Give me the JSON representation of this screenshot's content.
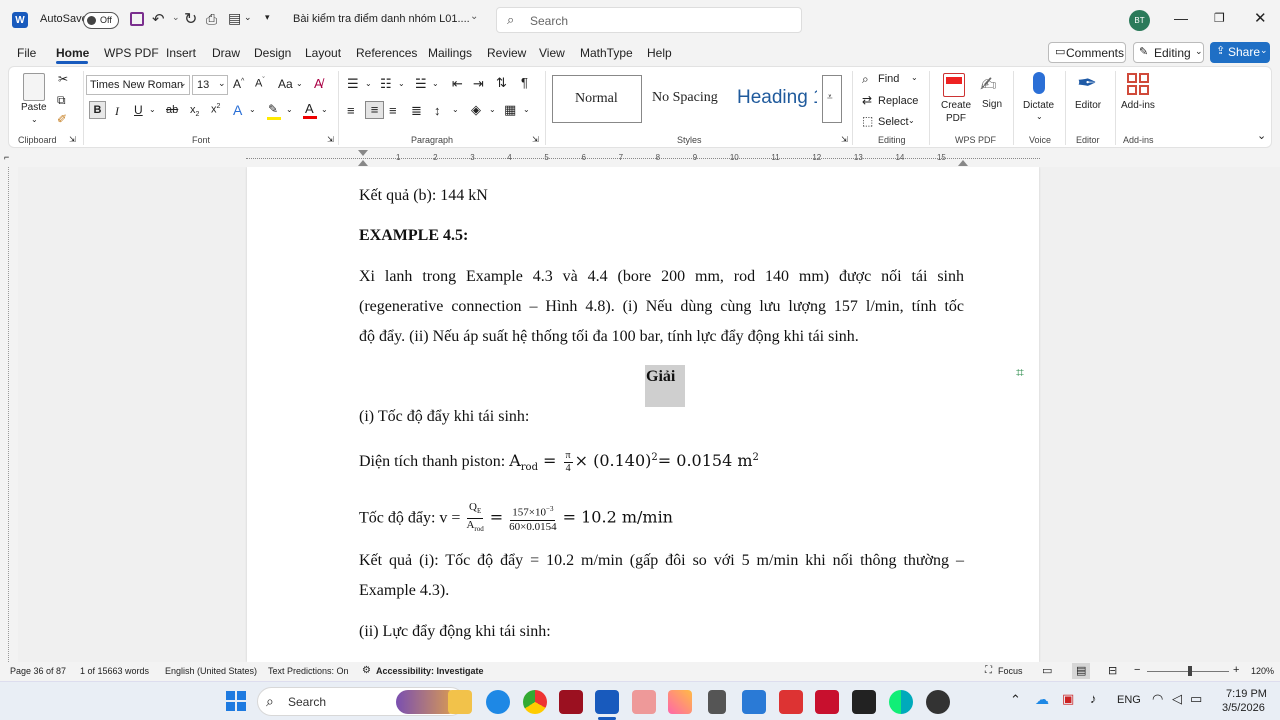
{
  "titlebar": {
    "autosave_label": "AutoSave",
    "autosave_state": "Off",
    "doc_title": "Bài kiểm tra điểm danh nhóm L01....",
    "search_placeholder": "Search",
    "user_initials": "BT"
  },
  "menu": {
    "tabs": [
      "File",
      "Home",
      "WPS PDF",
      "Insert",
      "Draw",
      "Design",
      "Layout",
      "References",
      "Mailings",
      "Review",
      "View",
      "MathType",
      "Help"
    ],
    "active_tab": "Home",
    "comments": "Comments",
    "editing": "Editing",
    "share": "Share"
  },
  "ribbon": {
    "paste": "Paste",
    "font_name": "Times New Roman",
    "font_size": "13",
    "styles": [
      "Normal",
      "No Spacing",
      "Heading 1"
    ],
    "find": "Find",
    "replace": "Replace",
    "select": "Select",
    "create_pdf": "Create PDF",
    "sign": "Sign",
    "dictate": "Dictate",
    "editor": "Editor",
    "addins": "Add-ins",
    "groups": [
      "Clipboard",
      "Font",
      "Paragraph",
      "Styles",
      "Editing",
      "WPS PDF",
      "Voice",
      "Editor",
      "Add-ins"
    ]
  },
  "document": {
    "line1": "Kết quả (b): 144 kN",
    "heading": "EXAMPLE 4.5:",
    "para1_l1": "Xi lanh trong Example 4.3 và 4.4 (bore 200 mm, rod 140 mm) được nối tái sinh",
    "para1_l2": "(regenerative connection – Hình 4.8). (i) Nếu dùng cùng lưu lượng 157 l/min, tính tốc",
    "para1_l3": "độ đẩy. (ii) Nếu áp suất hệ thống tối đa 100 bar, tính lực đẩy động khi tái sinh.",
    "giai": "Giải",
    "sub_i": "(i) Tốc độ đẩy khi tái sinh:",
    "area_label": "Diện tích thanh piston: ",
    "area_expr_lhs": "A",
    "area_expr_sub": "rod",
    "area_expr_rhs": "× (0.140)",
    "area_result": "= 0.0154 m",
    "speed_label": "Tốc độ đẩy: v =",
    "speed_frac1_num": "Q",
    "speed_frac1_num_sub": "E",
    "speed_frac1_den": "A",
    "speed_frac1_den_sub": "rod",
    "speed_frac2_num": "157×10",
    "speed_frac2_num_sup": "−3",
    "speed_frac2_den": "60×0.0154",
    "speed_result": "= 10.2 m/min",
    "result_l1": "Kết quả (i): Tốc độ đẩy = 10.2 m/min (gấp đôi so với 5 m/min khi nối thông thường –",
    "result_l2": "Example 4.3).",
    "sub_ii": "(ii) Lực đẩy động khi tái sinh:"
  },
  "status": {
    "page": "Page 36 of 87",
    "words": "1 of 15663 words",
    "language": "English (United States)",
    "predictions": "Text Predictions: On",
    "accessibility": "Accessibility: Investigate",
    "focus": "Focus",
    "zoom": "120%"
  },
  "taskbar": {
    "search": "Search",
    "lang": "ENG",
    "time": "7:19 PM",
    "date": "3/5/2026"
  },
  "colors": {
    "accent": "#185abd",
    "share_bg": "#1f6fc5",
    "chrome": "#f3f3f3"
  }
}
